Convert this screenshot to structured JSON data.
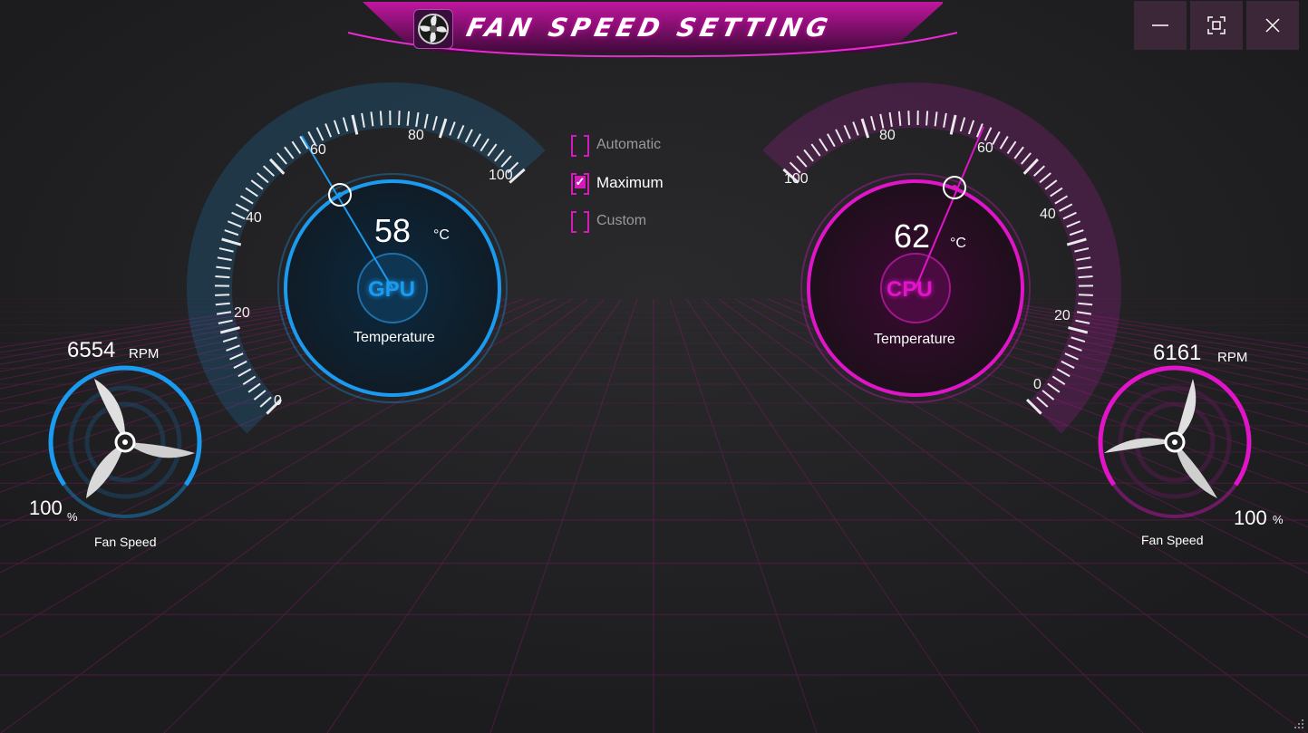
{
  "window": {
    "title": "FAN SPEED SETTING",
    "controls": {
      "minimize_icon": "minimize-icon",
      "maximize_icon": "maximize-icon",
      "close_icon": "close-icon"
    }
  },
  "colors": {
    "gpu_accent": "#1a9bf0",
    "cpu_accent": "#e014c8",
    "background": "#1e1e20"
  },
  "gpu_gauge": {
    "name": "GPU",
    "temperature": "58",
    "unit": "°C",
    "caption": "Temperature",
    "scale_labels": [
      "0",
      "20",
      "40",
      "60",
      "80",
      "100"
    ]
  },
  "cpu_gauge": {
    "name": "CPU",
    "temperature": "62",
    "unit": "°C",
    "caption": "Temperature",
    "scale_labels": [
      "0",
      "20",
      "40",
      "60",
      "80",
      "100"
    ]
  },
  "fan_mode": {
    "options": [
      {
        "label": "Automatic",
        "checked": false
      },
      {
        "label": "Maximum",
        "checked": true
      },
      {
        "label": "Custom",
        "checked": false
      }
    ]
  },
  "gpu_fan": {
    "rpm": "6554",
    "rpm_unit": "RPM",
    "percent": "100",
    "percent_unit": "%",
    "caption": "Fan Speed",
    "level": 1.0
  },
  "cpu_fan": {
    "rpm": "6161",
    "rpm_unit": "RPM",
    "percent": "100",
    "percent_unit": "%",
    "caption": "Fan Speed",
    "level": 1.0
  }
}
